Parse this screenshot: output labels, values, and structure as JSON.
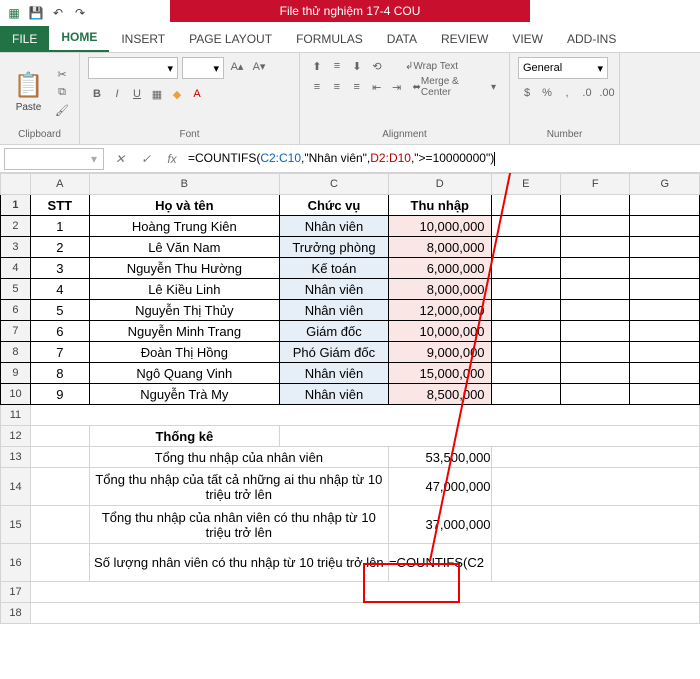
{
  "title": "File thử nghiệm 17-4 COU",
  "tabs": {
    "file": "FILE",
    "home": "HOME",
    "insert": "INSERT",
    "pagelayout": "PAGE LAYOUT",
    "formulas": "FORMULAS",
    "data": "DATA",
    "review": "REVIEW",
    "view": "VIEW",
    "addins": "ADD-INS"
  },
  "ribbon": {
    "clipboard": "Clipboard",
    "paste": "Paste",
    "font_group": "Font",
    "font_size": "A",
    "num_group": "Number",
    "wrap": "Wrap Text",
    "merge": "Merge & Center",
    "align": "Alignment",
    "numfmt": "General"
  },
  "formula": {
    "p1": "=COUNTIFS(",
    "r1": "C2:C10",
    "p2": ",\"Nhân viên\",",
    "r2": "D2:D10",
    "p3": ",\">=10000000\")"
  },
  "headers": {
    "A": "A",
    "B": "B",
    "C": "C",
    "D": "D",
    "E": "E",
    "F": "F",
    "G": "G"
  },
  "th": {
    "stt": "STT",
    "name": "Họ và tên",
    "pos": "Chức vụ",
    "inc": "Thu nhập"
  },
  "rows": [
    {
      "stt": "1",
      "name": "Hoàng Trung Kiên",
      "pos": "Nhân viên",
      "inc": "10,000,000"
    },
    {
      "stt": "2",
      "name": "Lê Văn Nam",
      "pos": "Trưởng phòng",
      "inc": "8,000,000"
    },
    {
      "stt": "3",
      "name": "Nguyễn Thu Hường",
      "pos": "Kế toán",
      "inc": "6,000,000"
    },
    {
      "stt": "4",
      "name": "Lê Kiều Linh",
      "pos": "Nhân viên",
      "inc": "8,000,000"
    },
    {
      "stt": "5",
      "name": "Nguyễn Thị Thủy",
      "pos": "Nhân viên",
      "inc": "12,000,000"
    },
    {
      "stt": "6",
      "name": "Nguyễn Minh Trang",
      "pos": "Giám đốc",
      "inc": "10,000,000"
    },
    {
      "stt": "7",
      "name": "Đoàn Thị Hồng",
      "pos": "Phó Giám đốc",
      "inc": "9,000,000"
    },
    {
      "stt": "8",
      "name": "Ngô Quang Vinh",
      "pos": "Nhân viên",
      "inc": "15,000,000"
    },
    {
      "stt": "9",
      "name": "Nguyễn Trà My",
      "pos": "Nhân viên",
      "inc": "8,500,000"
    }
  ],
  "stats_title": "Thống kê",
  "stats": [
    {
      "label": "Tổng thu nhập của nhân viên",
      "val": "53,500,000"
    },
    {
      "label": "Tổng thu nhập của tất cả những ai thu nhập từ 10 triệu trở lên",
      "val": "47,000,000"
    },
    {
      "label": "Tổng thu nhập của nhân viên có thu nhập từ 10 triệu trở lên",
      "val": "37,000,000"
    },
    {
      "label": "Số lượng nhân viên có thu nhập từ 10 triệu trở lên",
      "val": "=COUNTIFS(C2"
    }
  ]
}
